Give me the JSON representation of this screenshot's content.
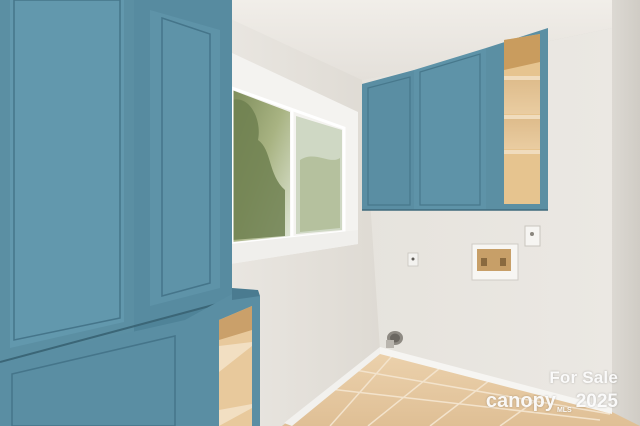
{
  "photo": {
    "subject": "laundry-room",
    "colors": {
      "wall": "#e9e6e1",
      "ceiling": "#eeebe6",
      "cabinet": "#5b8fa3",
      "cabinet_dark": "#4a7a8e",
      "floor_tile": "#e7c9a2",
      "baseboard": "#f5f4f1",
      "shelf_wood": "#e6c9a0"
    }
  },
  "watermark": {
    "line1": "For Sale",
    "brand": "canopy",
    "mls": "MLS",
    "year": "2025"
  }
}
